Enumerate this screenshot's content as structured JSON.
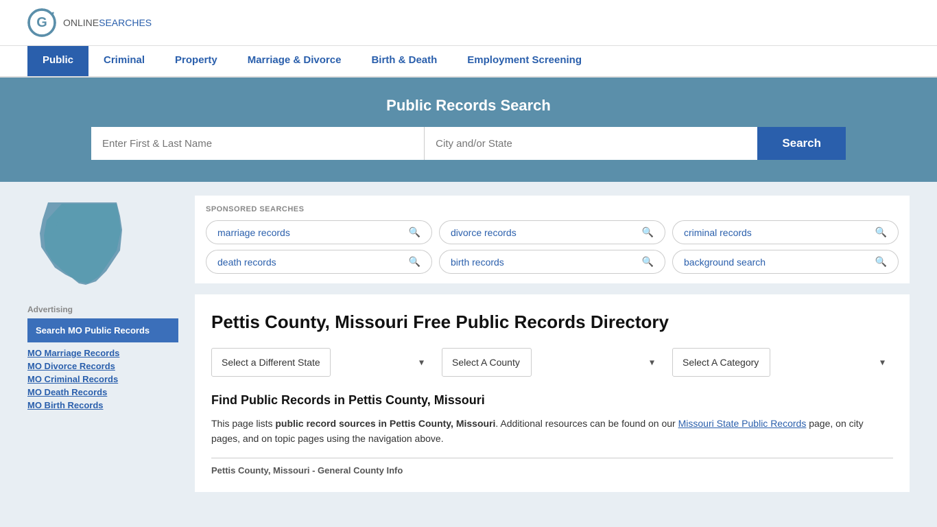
{
  "header": {
    "logo_online": "ONLINE",
    "logo_searches": "SEARCHES"
  },
  "nav": {
    "items": [
      {
        "label": "Public",
        "active": true
      },
      {
        "label": "Criminal",
        "active": false
      },
      {
        "label": "Property",
        "active": false
      },
      {
        "label": "Marriage & Divorce",
        "active": false
      },
      {
        "label": "Birth & Death",
        "active": false
      },
      {
        "label": "Employment Screening",
        "active": false
      }
    ]
  },
  "search_banner": {
    "title": "Public Records Search",
    "name_placeholder": "Enter First & Last Name",
    "location_placeholder": "City and/or State",
    "button_label": "Search"
  },
  "sponsored": {
    "label": "SPONSORED SEARCHES",
    "pills": [
      [
        "marriage records",
        "divorce records",
        "criminal records"
      ],
      [
        "death records",
        "birth records",
        "background search"
      ]
    ]
  },
  "directory": {
    "title": "Pettis County, Missouri Free Public Records Directory",
    "dropdown_state": "Select a Different State",
    "dropdown_county": "Select A County",
    "dropdown_category": "Select A Category",
    "find_title": "Find Public Records in Pettis County, Missouri",
    "find_text_1": "This page lists ",
    "find_bold_1": "public record sources in Pettis County, Missouri",
    "find_text_2": ". Additional resources can be found on our ",
    "find_link": "Missouri State Public Records",
    "find_text_3": " page, on city pages, and on topic pages using the navigation above.",
    "general_info": "Pettis County, Missouri - General County Info"
  },
  "sidebar": {
    "ad_label": "Advertising",
    "ad_active": "Search MO Public Records",
    "links": [
      "MO Marriage Records",
      "MO Divorce Records",
      "MO Criminal Records",
      "MO Death Records",
      "MO Birth Records"
    ]
  }
}
